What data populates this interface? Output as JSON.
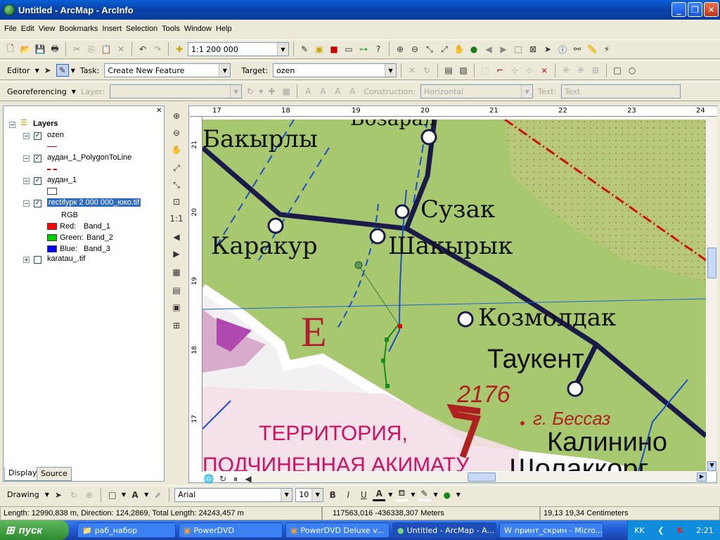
{
  "window": {
    "title": "Untitled - ArcMap - ArcInfo"
  },
  "menu": [
    "File",
    "Edit",
    "View",
    "Bookmarks",
    "Insert",
    "Selection",
    "Tools",
    "Window",
    "Help"
  ],
  "standard": {
    "scale": "1:1 200 000"
  },
  "editor": {
    "editor_label": "Editor",
    "task_label": "Task:",
    "task_value": "Create New Feature",
    "target_label": "Target:",
    "target_value": "ozen"
  },
  "georef": {
    "label": "Georeferencing",
    "layer_label": "Layer:",
    "construction_label": "Construction:",
    "construction_value": "Horizontal",
    "text_label": "Text:",
    "text_value": "Text"
  },
  "toc": {
    "root": "Layers",
    "layers": [
      {
        "name": "ozen"
      },
      {
        "name": "аудан_1_PolygonToLine"
      },
      {
        "name": "аудан_1"
      },
      {
        "name": "rectifyрк 2 000 000_юко.tif"
      },
      {
        "name": "karatau_.tif"
      }
    ],
    "rgb": "RGB",
    "bands": [
      {
        "name": "Red:",
        "band": "Band_1",
        "color": "#ff0000"
      },
      {
        "name": "Green:",
        "band": "Band_2",
        "color": "#00cc00"
      },
      {
        "name": "Blue:",
        "band": "Band_3",
        "color": "#0000ff"
      }
    ],
    "tabs": [
      "Display",
      "Source"
    ]
  },
  "ruler": {
    "top": [
      "17",
      "18",
      "19",
      "20",
      "21",
      "22",
      "23",
      "24"
    ],
    "left": [
      "21",
      "20",
      "19",
      "18",
      "17"
    ]
  },
  "map": {
    "labels": {
      "l1": "Бакырлы",
      "l2": "Сузак",
      "l3": "Каракур",
      "l4": "Шакырык",
      "l5": "Козмолдак",
      "l6": "Таукент",
      "l7": "2176",
      "l8": "г. Бессаз",
      "l9": "Калинино",
      "l10": "ТЕРРИТОРИЯ,",
      "l11": "ПОДЧИНЕННАЯ АКИМАТУ",
      "l12": "Е",
      "l13": "Т",
      "l14": "Шолаккорг",
      "l15": "Бозарал"
    }
  },
  "drawing": {
    "label": "Drawing",
    "font": "Arial",
    "size": "10"
  },
  "status": {
    "left": "Length: 12990,838 m, Direction: 124,2869, Total Length: 24243,457 m",
    "coords": "117563,016  -436338,307 Meters",
    "page": "19,13  19,34 Centimeters"
  },
  "taskbar": {
    "start": "пуск",
    "tasks": [
      "раб_набор",
      "PowerDVD",
      "PowerDVD Deluxe v...",
      "Untitled - ArcMap - A...",
      "принт_скрин - Micro..."
    ],
    "lang": "KK",
    "time": "2:21"
  }
}
